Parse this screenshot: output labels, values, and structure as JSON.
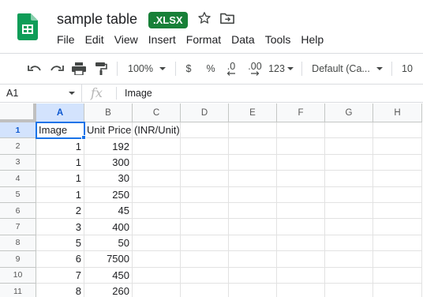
{
  "doc": {
    "title": "sample table",
    "format_badge": ".XLSX"
  },
  "menu": [
    "File",
    "Edit",
    "View",
    "Insert",
    "Format",
    "Data",
    "Tools",
    "Help"
  ],
  "toolbar": {
    "zoom": "100%",
    "currency": "$",
    "percent": "%",
    "decrease_decimal": ".0",
    "increase_decimal": ".00",
    "more_formats": "123",
    "font": "Default (Ca...",
    "font_size": "10"
  },
  "formula_bar": {
    "cell_ref": "A1",
    "fx": "fx",
    "value": "Image"
  },
  "sheet": {
    "columns": [
      "A",
      "B",
      "C",
      "D",
      "E",
      "F",
      "G",
      "H"
    ],
    "rows": [
      "1",
      "2",
      "3",
      "4",
      "5",
      "6",
      "7",
      "8",
      "9",
      "10",
      "11"
    ],
    "cells": [
      [
        "Image",
        "Unit Price (INR/Unit)"
      ],
      [
        "1",
        "192"
      ],
      [
        "1",
        "300"
      ],
      [
        "1",
        "30"
      ],
      [
        "1",
        "250"
      ],
      [
        "2",
        "45"
      ],
      [
        "3",
        "400"
      ],
      [
        "5",
        "50"
      ],
      [
        "6",
        "7500"
      ],
      [
        "7",
        "450"
      ],
      [
        "8",
        "260"
      ]
    ]
  },
  "colors": {
    "brand_green": "#188038",
    "selection_blue": "#1a73e8",
    "header_selected": "#d3e3fd"
  }
}
